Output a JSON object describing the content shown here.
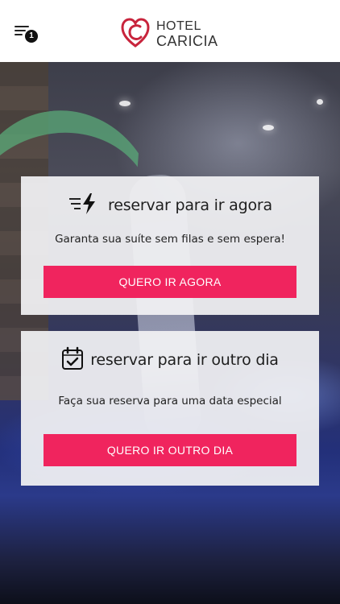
{
  "header": {
    "menu_badge": "1",
    "logo_line1": "HOTEL",
    "logo_line2": "CARICIA"
  },
  "options": [
    {
      "title": "reservar para ir agora",
      "description": "Garanta sua suíte sem filas e sem espera!",
      "button_label": "QUERO IR AGORA",
      "icon": "fast-lightning-icon"
    },
    {
      "title": "reservar para ir outro dia",
      "description": "Faça sua reserva para uma data especial",
      "button_label": "QUERO IR OUTRO DIA",
      "icon": "calendar-check-icon"
    }
  ],
  "colors": {
    "accent": "#f0245e",
    "header_bg": "#ffffff",
    "card_bg": "#f2f2f4",
    "logo_red": "#c8243c"
  }
}
